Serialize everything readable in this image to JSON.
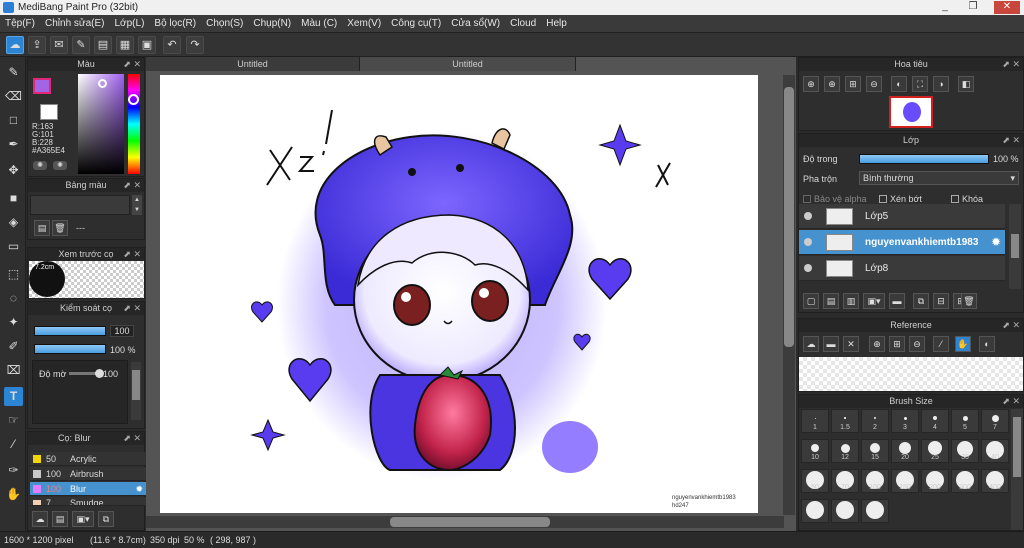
{
  "window": {
    "title": "MediBang Paint Pro (32bit)",
    "controls": [
      "_",
      "❐",
      "✕",
      "⎘"
    ]
  },
  "menu": [
    "Tệp(F)",
    "Chỉnh sửa(E)",
    "Lớp(L)",
    "Bộ lọc(R)",
    "Chọn(S)",
    "Chụp(N)",
    "Màu (C)",
    "Xem(V)",
    "Công cụ(T)",
    "Cửa sổ(W)",
    "Cloud",
    "Help"
  ],
  "toolbar_icons": [
    "cloud-icon",
    "share-icon",
    "comment-icon",
    "comment-edit-icon",
    "document-icon",
    "grid-icon",
    "tiles-icon",
    "undo-icon",
    "redo-icon"
  ],
  "left_tools": [
    "brush-icon",
    "eraser-icon",
    "rectangle-icon",
    "pen-icon",
    "move-icon",
    "fill-rect-icon",
    "bucket-icon",
    "gradient-icon",
    "select-rect-icon",
    "lasso-icon",
    "magic-wand-icon",
    "select-pen-icon",
    "select-eraser-icon",
    "text-icon",
    "hand-select-icon",
    "eyedropper-icon",
    "dropper-icon",
    "hand-icon"
  ],
  "color_panel": {
    "title": "Màu",
    "r": "R:163",
    "g": "G:101",
    "b": "B:228",
    "hex": "#A365E4",
    "fg_color": "#a365e4",
    "bg_color": "#ffffff"
  },
  "palette_panel": {
    "title": "Bảng màu",
    "value": "---"
  },
  "brush_preview_panel": {
    "title": "Xem trước cọ",
    "size": "7.2cm"
  },
  "brush_control_panel": {
    "title": "Kiểm soát cọ",
    "size_value": "100",
    "opacity_value": "100 %",
    "blur_label": "Độ mờ",
    "blur_value": "100",
    "size_fraction": 1.0,
    "opacity_fraction": 1.0,
    "blur_fraction": 1.0
  },
  "brush_list_panel": {
    "title": "Cọ: Blur",
    "items": [
      {
        "size": "50",
        "name": "Acrylic",
        "color": "#f2d600"
      },
      {
        "size": "100",
        "name": "Airbrush",
        "color": "#c8c8c8"
      },
      {
        "size": "100",
        "name": "Blur",
        "color": "#e07cff",
        "selected": true
      },
      {
        "size": "7",
        "name": "Smudge",
        "color": "#f0d0b0"
      }
    ]
  },
  "canvas": {
    "tabs": [
      "Untitled",
      "Untitled"
    ],
    "active_tab": 1,
    "signature": [
      "nguyenvankhiemtb1983",
      "hd247"
    ]
  },
  "navigator_panel": {
    "title": "Hoa tiêu"
  },
  "layer_panel": {
    "title": "Lớp",
    "opacity_label": "Độ trong",
    "opacity_value": "100 %",
    "opacity_fraction": 1.0,
    "blend_label": "Pha trộn",
    "blend_value": "Bình thường",
    "protect_alpha": "Bảo vệ alpha",
    "clipping": "Xén bớt",
    "lock": "Khóa",
    "layers": [
      {
        "name": "Lớp5",
        "selected": false
      },
      {
        "name": "nguyenvankhiemtb1983",
        "selected": true
      },
      {
        "name": "Lớp8",
        "selected": false
      }
    ]
  },
  "reference_panel": {
    "title": "Reference"
  },
  "brush_size_panel": {
    "title": "Brush Size",
    "sizes": [
      "1",
      "1.5",
      "2",
      "3",
      "4",
      "5",
      "7",
      "10",
      "12",
      "15",
      "20",
      "25",
      "30",
      "40",
      "50",
      "70",
      "100",
      "150",
      "200",
      "300",
      "400",
      "",
      "",
      ""
    ]
  },
  "status": {
    "dimensions": "1600 * 1200 pixel",
    "physical": "(11.6 * 8.7cm)",
    "dpi": "350 dpi",
    "zoom": "50 %",
    "coords": "( 298, 987 )"
  }
}
